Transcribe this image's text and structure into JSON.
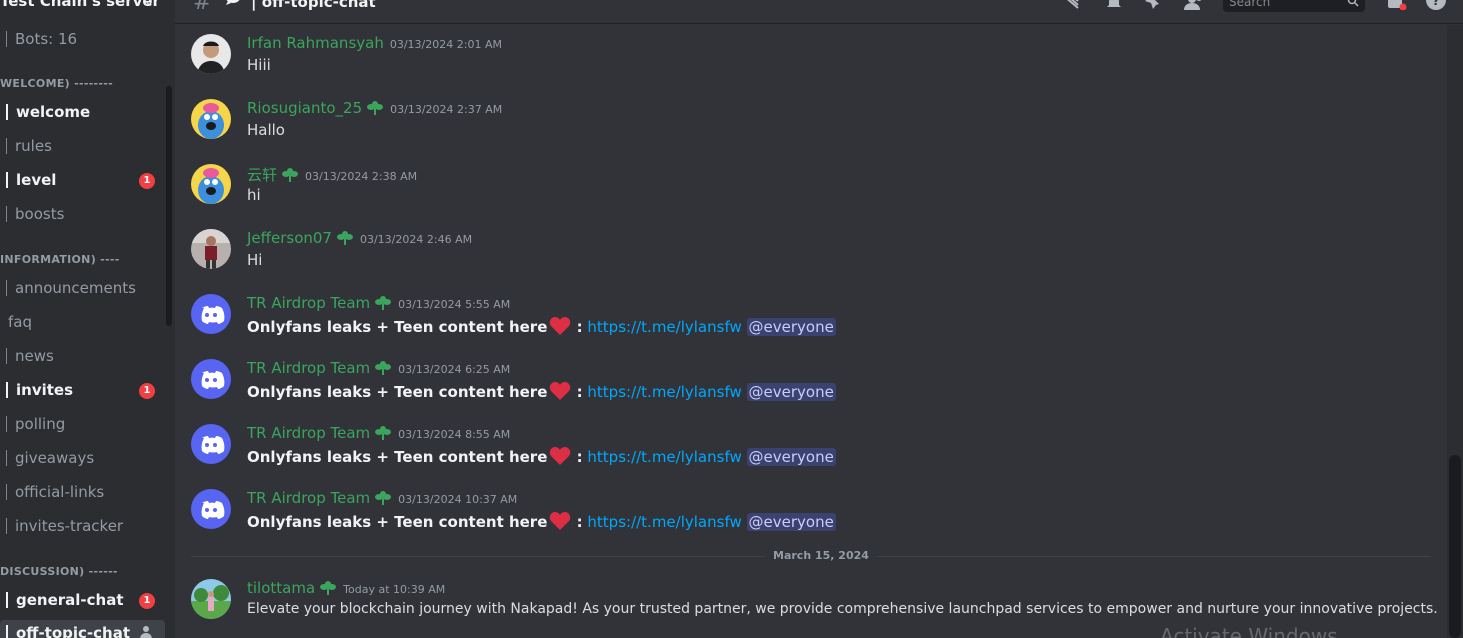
{
  "server": {
    "title": "Test Chain's server"
  },
  "sidebar": {
    "bots_label": "Bots: 16",
    "categories": {
      "welcome": "WELCOME) --------",
      "information": "INFORMATION) ----",
      "discussion": "DISCUSSION) ------"
    },
    "channels": [
      {
        "name": "welcome",
        "unread": true,
        "badge": ""
      },
      {
        "name": "rules",
        "unread": false,
        "badge": ""
      },
      {
        "name": "level",
        "unread": true,
        "badge": "1"
      },
      {
        "name": "boosts",
        "unread": false,
        "badge": ""
      },
      {
        "name": "announcements",
        "unread": false,
        "badge": ""
      },
      {
        "name": "faq",
        "unread": false,
        "badge": ""
      },
      {
        "name": "news",
        "unread": false,
        "badge": ""
      },
      {
        "name": "invites",
        "unread": true,
        "badge": "1"
      },
      {
        "name": "polling",
        "unread": false,
        "badge": ""
      },
      {
        "name": "giveaways",
        "unread": false,
        "badge": ""
      },
      {
        "name": "official-links",
        "unread": false,
        "badge": ""
      },
      {
        "name": "invites-tracker",
        "unread": false,
        "badge": ""
      },
      {
        "name": "general-chat",
        "unread": true,
        "badge": "1"
      },
      {
        "name": "off-topic-chat",
        "unread": true,
        "badge": ""
      }
    ]
  },
  "header": {
    "channel_title": "off-topic-chat",
    "search_placeholder": "Search"
  },
  "messages": [
    {
      "author": "Irfan Rahmansyah",
      "timestamp": "03/13/2024 2:01 AM",
      "text": "Hiii",
      "badge": false,
      "avatar": "photo-man"
    },
    {
      "author": "Riosugianto_25",
      "timestamp": "03/13/2024 2:37 AM",
      "text": "Hallo",
      "badge": true,
      "avatar": "blue-creature"
    },
    {
      "author": "云轩",
      "timestamp": "03/13/2024 2:38 AM",
      "text": "hi",
      "badge": true,
      "avatar": "blue-creature"
    },
    {
      "author": "Jefferson07",
      "timestamp": "03/13/2024 2:46 AM",
      "text": "Hi",
      "badge": true,
      "avatar": "photo-person"
    },
    {
      "author": "TR Airdrop Team",
      "timestamp": "03/13/2024 5:55 AM",
      "bold": "Onlyfans leaks + Teen content here",
      "colon": " :",
      "link": "https://t.me/lylansfw",
      "mention": "@everyone",
      "badge": true,
      "avatar": "discord-logo"
    },
    {
      "author": "TR Airdrop Team",
      "timestamp": "03/13/2024 6:25 AM",
      "bold": "Onlyfans leaks + Teen content here",
      "colon": " :",
      "link": "https://t.me/lylansfw",
      "mention": "@everyone",
      "badge": true,
      "avatar": "discord-logo"
    },
    {
      "author": "TR Airdrop Team",
      "timestamp": "03/13/2024 8:55 AM",
      "bold": "Onlyfans leaks + Teen content here",
      "colon": " :",
      "link": "https://t.me/lylansfw",
      "mention": "@everyone",
      "badge": true,
      "avatar": "discord-logo"
    },
    {
      "author": "TR Airdrop Team",
      "timestamp": "03/13/2024 10:37 AM",
      "bold": "Onlyfans leaks + Teen content here",
      "colon": " :",
      "link": "https://t.me/lylansfw",
      "mention": "@everyone",
      "badge": true,
      "avatar": "discord-logo"
    },
    {
      "author": "tilottama",
      "timestamp": "Today at 10:39 AM",
      "text": "Elevate your blockchain journey with Nakapad! As your trusted partner, we provide comprehensive launchpad services to empower and nurture your innovative projects.",
      "badge": true,
      "avatar": "photo-landscape"
    }
  ],
  "date_divider": "March 15, 2024",
  "watermark": "Activate Windows",
  "colors": {
    "username": "#3ba55d",
    "link": "#00a8fc",
    "mention_bg": "#3c4270",
    "badge_red": "#f23f43",
    "blurple": "#5865f2"
  }
}
